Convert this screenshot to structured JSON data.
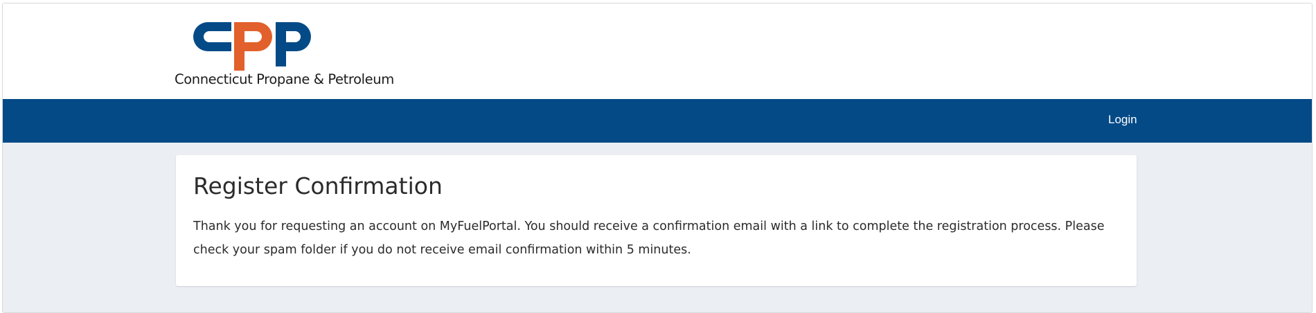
{
  "brand": {
    "logo_letters": "cpp",
    "name": "Connecticut Propane & Petroleum",
    "colors": {
      "blue": "#044a87",
      "orange": "#e2602b"
    }
  },
  "nav": {
    "login_label": "Login"
  },
  "confirmation": {
    "title": "Register Confirmation",
    "message": "Thank you for requesting an account on MyFuelPortal. You should receive a confirmation email with a link to complete the registration process. Please check your spam folder if you do not receive email confirmation within 5 minutes."
  }
}
